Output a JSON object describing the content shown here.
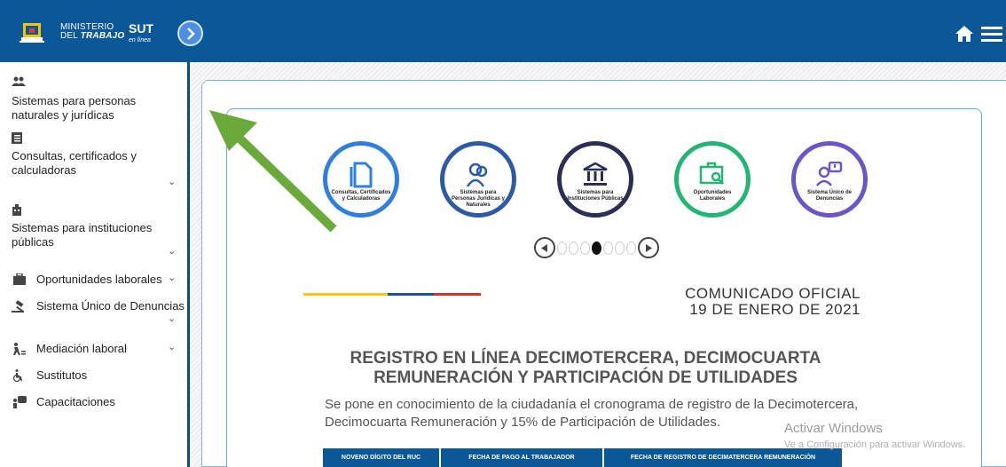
{
  "header": {
    "ministerio_line1": "MINISTERIO",
    "ministerio_line2_a": "DEL",
    "ministerio_line2_b": "TRABAJO",
    "sut": "SUT",
    "sut_sub": "en línea"
  },
  "sidebar": {
    "items": [
      {
        "label": "Sistemas para personas naturales y jurídicas",
        "icon": "people-icon"
      },
      {
        "label": "Consultas, certificados y calculadoras",
        "icon": "document-list-icon"
      },
      {
        "label": "Sistemas para instituciones públicas",
        "icon": "building-icon"
      },
      {
        "label": "Oportunidades laborales",
        "icon": "briefcase-icon"
      },
      {
        "label": "Sistema Único de Denuncias",
        "icon": "gavel-icon"
      },
      {
        "label": "Mediación laboral",
        "icon": "walking-icon"
      },
      {
        "label": "Sustitutos",
        "icon": "wheelchair-icon"
      },
      {
        "label": "Capacitaciones",
        "icon": "training-icon"
      }
    ]
  },
  "carousel": {
    "items": [
      {
        "label": "Consultas, Certificados y Calculadoras",
        "color": "#2f7fe0"
      },
      {
        "label": "Sistemas para Personas Jurídicas y Naturales",
        "color": "#2c5aa8"
      },
      {
        "label": "Sistemas para Instituciones Públicas",
        "color": "#2b2f55"
      },
      {
        "label": "Oportunidades Laborales",
        "color": "#22b573"
      },
      {
        "label": "Sistema Único de Denuncias",
        "color": "#6b55c9"
      }
    ],
    "active_index": 3
  },
  "announcement": {
    "comunicado_line1": "COMUNICADO OFICIAL",
    "comunicado_line2": "19 DE ENERO DE 2021",
    "headline": "REGISTRO EN LÍNEA DECIMOTERCERA, DECIMOCUARTA REMUNERACIÓN Y PARTICIPACIÓN DE UTILIDADES",
    "paragraph": "Se pone en conocimiento de la ciudadanía el cronograma de registro de la Decimotercera, Decimocuarta Remuneración y 15% de Participación de Utilidades.",
    "table_headers": [
      "NOVENO DÍGITO DEL RUC",
      "FECHA DE PAGO AL TRABAJADOR",
      "FECHA DE REGISTRO DE DECIMATERCERA REMUNERACIÓN"
    ]
  },
  "watermark": {
    "line1": "Activar Windows",
    "line2": "Ve a Configuración para activar Windows."
  },
  "colors": {
    "header_bg": "#0b5797",
    "arrow": "#6aaa3a"
  }
}
